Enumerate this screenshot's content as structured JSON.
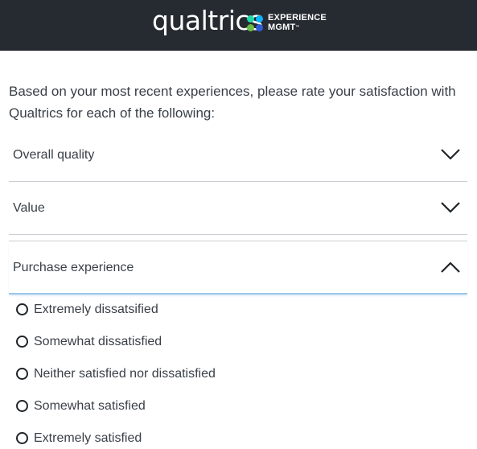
{
  "header": {
    "brand": "qualtrics",
    "tagline_line1": "EXPERIENCE",
    "tagline_line2": "MGMT",
    "tagline_mark": "™",
    "dot_colors": [
      "#21dbaa",
      "#0bb4ff",
      "#6bbe45",
      "#2f5cd7"
    ]
  },
  "question": {
    "text": "Based on your most recent experiences, please rate your satisfaction with Qualtrics for each of the following:"
  },
  "accordion": [
    {
      "label": "Overall quality",
      "state": "collapsed"
    },
    {
      "label": "Value",
      "state": "collapsed"
    },
    {
      "label": "Purchase experience",
      "state": "expanded"
    }
  ],
  "options": [
    "Extremely dissatsified",
    "Somewhat dissatisfied",
    "Neither satisfied nor dissatisfied",
    "Somewhat satisfied",
    "Extremely satisfied"
  ]
}
